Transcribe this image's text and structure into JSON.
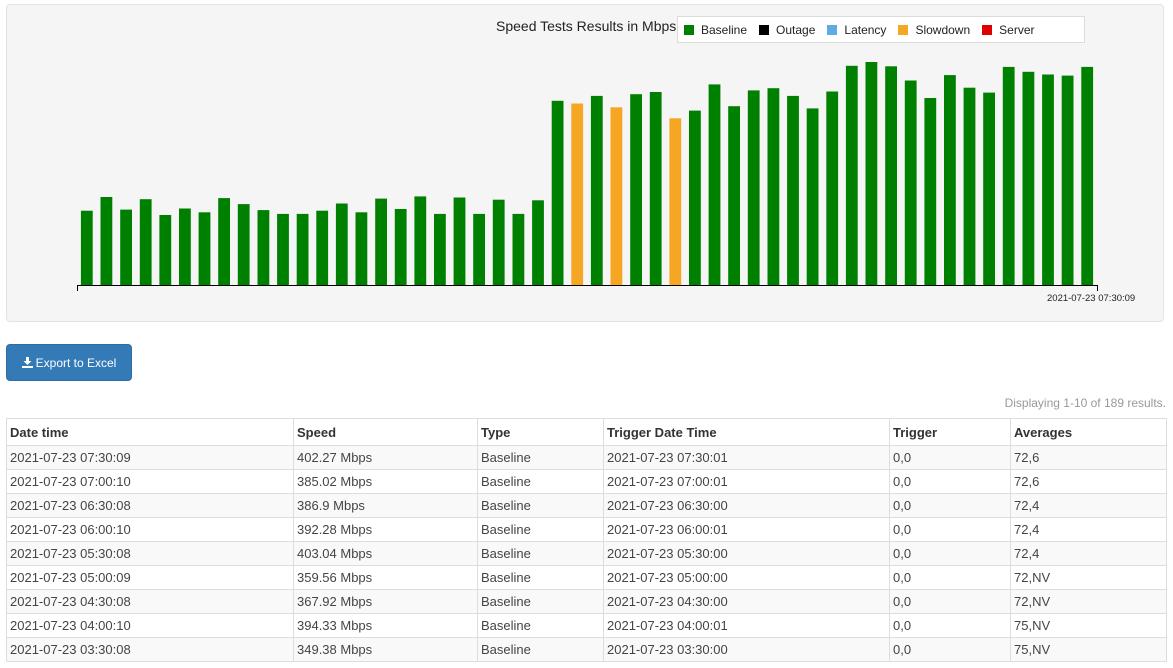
{
  "chart": {
    "legend": [
      {
        "label": "Baseline",
        "color": "#008000"
      },
      {
        "label": "Outage",
        "color": "#000000"
      },
      {
        "label": "Latency",
        "color": "#5dade2"
      },
      {
        "label": "Slowdown",
        "color": "#f5a623"
      },
      {
        "label": "Server",
        "color": "#e00000"
      }
    ]
  },
  "chart_data": {
    "type": "bar",
    "title": "Speed Tests Results in Mbps",
    "x_tick_label": "2021-07-23 07:30:09",
    "ylim": [
      0,
      450
    ],
    "grid": false,
    "legend_position": "top-right",
    "values": [
      136,
      161,
      138,
      157,
      128,
      140,
      133,
      159,
      148,
      137,
      130,
      130,
      136,
      149,
      133,
      158,
      139,
      162,
      130,
      160,
      130,
      156,
      130,
      155,
      337,
      332,
      346,
      325,
      349,
      353,
      305,
      319,
      367,
      327,
      356,
      360,
      346,
      323,
      354,
      401,
      408,
      400,
      374,
      342,
      384,
      361,
      352,
      399,
      390,
      385,
      383,
      399
    ],
    "types": [
      "Baseline",
      "Baseline",
      "Baseline",
      "Baseline",
      "Baseline",
      "Baseline",
      "Baseline",
      "Baseline",
      "Baseline",
      "Baseline",
      "Baseline",
      "Baseline",
      "Baseline",
      "Baseline",
      "Baseline",
      "Baseline",
      "Baseline",
      "Baseline",
      "Baseline",
      "Baseline",
      "Baseline",
      "Baseline",
      "Baseline",
      "Baseline",
      "Baseline",
      "Slowdown",
      "Baseline",
      "Slowdown",
      "Baseline",
      "Baseline",
      "Slowdown",
      "Baseline",
      "Baseline",
      "Baseline",
      "Baseline",
      "Baseline",
      "Baseline",
      "Baseline",
      "Baseline",
      "Baseline",
      "Baseline",
      "Baseline",
      "Baseline",
      "Baseline",
      "Baseline",
      "Baseline",
      "Baseline",
      "Baseline",
      "Baseline",
      "Baseline",
      "Baseline",
      "Baseline"
    ]
  },
  "toolbar": {
    "export_label": "Export to Excel"
  },
  "results": {
    "summary": "Displaying 1-10 of 189 results.",
    "columns": [
      "Date time",
      "Speed",
      "Type",
      "Trigger Date Time",
      "Trigger",
      "Averages"
    ],
    "rows": [
      [
        "2021-07-23 07:30:09",
        "402.27 Mbps",
        "Baseline",
        "2021-07-23 07:30:01",
        "0,0",
        "72,6"
      ],
      [
        "2021-07-23 07:00:10",
        "385.02 Mbps",
        "Baseline",
        "2021-07-23 07:00:01",
        "0,0",
        "72,6"
      ],
      [
        "2021-07-23 06:30:08",
        "386.9 Mbps",
        "Baseline",
        "2021-07-23 06:30:00",
        "0,0",
        "72,4"
      ],
      [
        "2021-07-23 06:00:10",
        "392.28 Mbps",
        "Baseline",
        "2021-07-23 06:00:01",
        "0,0",
        "72,4"
      ],
      [
        "2021-07-23 05:30:08",
        "403.04 Mbps",
        "Baseline",
        "2021-07-23 05:30:00",
        "0,0",
        "72,4"
      ],
      [
        "2021-07-23 05:00:09",
        "359.56 Mbps",
        "Baseline",
        "2021-07-23 05:00:00",
        "0,0",
        "72,NV"
      ],
      [
        "2021-07-23 04:30:08",
        "367.92 Mbps",
        "Baseline",
        "2021-07-23 04:30:00",
        "0,0",
        "72,NV"
      ],
      [
        "2021-07-23 04:00:10",
        "394.33 Mbps",
        "Baseline",
        "2021-07-23 04:00:01",
        "0,0",
        "75,NV"
      ],
      [
        "2021-07-23 03:30:08",
        "349.38 Mbps",
        "Baseline",
        "2021-07-23 03:30:00",
        "0,0",
        "75,NV"
      ]
    ]
  }
}
